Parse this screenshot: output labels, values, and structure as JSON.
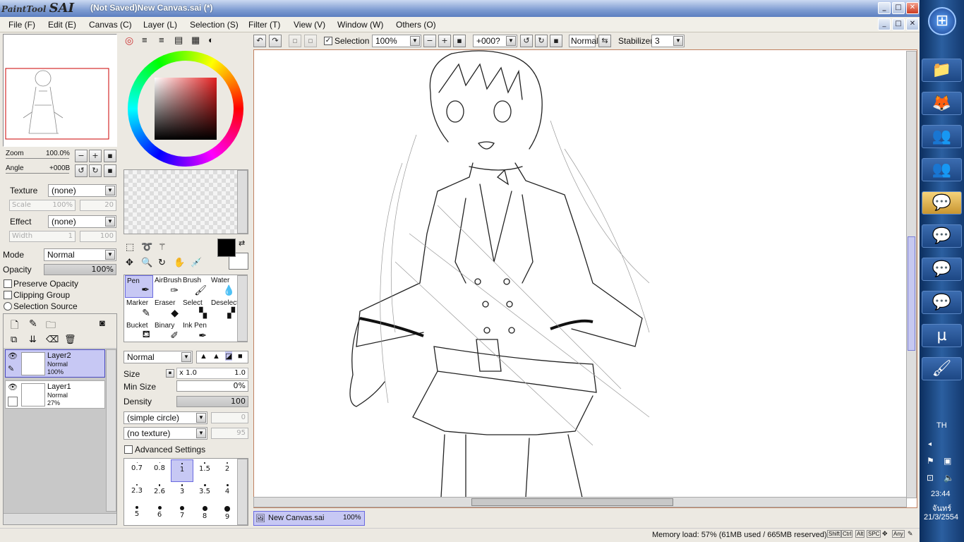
{
  "titlebar": {
    "logo_small": "PaintTool",
    "logo_big": "SAI",
    "title": "(Not Saved)New Canvas.sai (*)"
  },
  "menu": [
    "File (F)",
    "Edit (E)",
    "Canvas (C)",
    "Layer (L)",
    "Selection (S)",
    "Filter (T)",
    "View (V)",
    "Window (W)",
    "Others (O)"
  ],
  "navigator": {
    "zoom_label": "Zoom",
    "zoom_value": "100.0%",
    "angle_label": "Angle",
    "angle_value": "+000B"
  },
  "texture": {
    "label": "Texture",
    "value": "(none)",
    "scale_label": "Scale",
    "scale_value": "100%",
    "scale_amount": "20"
  },
  "effect": {
    "label": "Effect",
    "value": "(none)",
    "width_label": "Width",
    "width_value": "1",
    "width_amount": "100"
  },
  "layer_props": {
    "mode_label": "Mode",
    "mode_value": "Normal",
    "opacity_label": "Opacity",
    "opacity_value": "100%",
    "preserve": "Preserve Opacity",
    "clipping": "Clipping Group",
    "selsource": "Selection Source"
  },
  "layers": [
    {
      "name": "Layer2",
      "mode": "Normal",
      "opacity": "100%",
      "selected": true
    },
    {
      "name": "Layer1",
      "mode": "Normal",
      "opacity": "27%",
      "selected": false
    }
  ],
  "tools": [
    "Pen",
    "AirBrush",
    "Brush",
    "Water",
    "Marker",
    "Eraser",
    "Select",
    "Deselect",
    "Bucket",
    "Binary",
    "Ink Pen"
  ],
  "brush": {
    "blend": "Normal",
    "size_label": "Size",
    "size_mult": "x 1.0",
    "size_value": "1.0",
    "minsize_label": "Min Size",
    "minsize_value": "0%",
    "density_label": "Density",
    "density_value": "100",
    "shape": "(simple circle)",
    "shape_value": "0",
    "texture": "(no texture)",
    "texture_value": "95",
    "advanced": "Advanced Settings"
  },
  "brush_sizes": [
    "0.7",
    "0.8",
    "1",
    "1.5",
    "2",
    "2.3",
    "2.6",
    "3",
    "3.5",
    "4",
    "5",
    "6",
    "7",
    "8",
    "9"
  ],
  "toolbar": {
    "selection_label": "Selection",
    "zoom": "100%",
    "angle": "+000?",
    "mode": "Normal",
    "stabilizer_label": "Stabilizer",
    "stabilizer_value": "3"
  },
  "doc_tab": {
    "name": "New Canvas.sai",
    "zoom": "100%"
  },
  "status": {
    "memory": "Memory load: 57% (61MB used / 665MB reserved)",
    "keys": [
      "Shift",
      "Ctrl",
      "Alt",
      "SPC",
      "Any"
    ]
  },
  "taskbar": {
    "lang": "TH",
    "time": "23:44",
    "day": "จันทร์",
    "date": "21/3/2554"
  },
  "colors": {
    "accent": "#7d9bd1",
    "selected_layer": "#c7c8f4",
    "canvas": "#ffffff"
  }
}
